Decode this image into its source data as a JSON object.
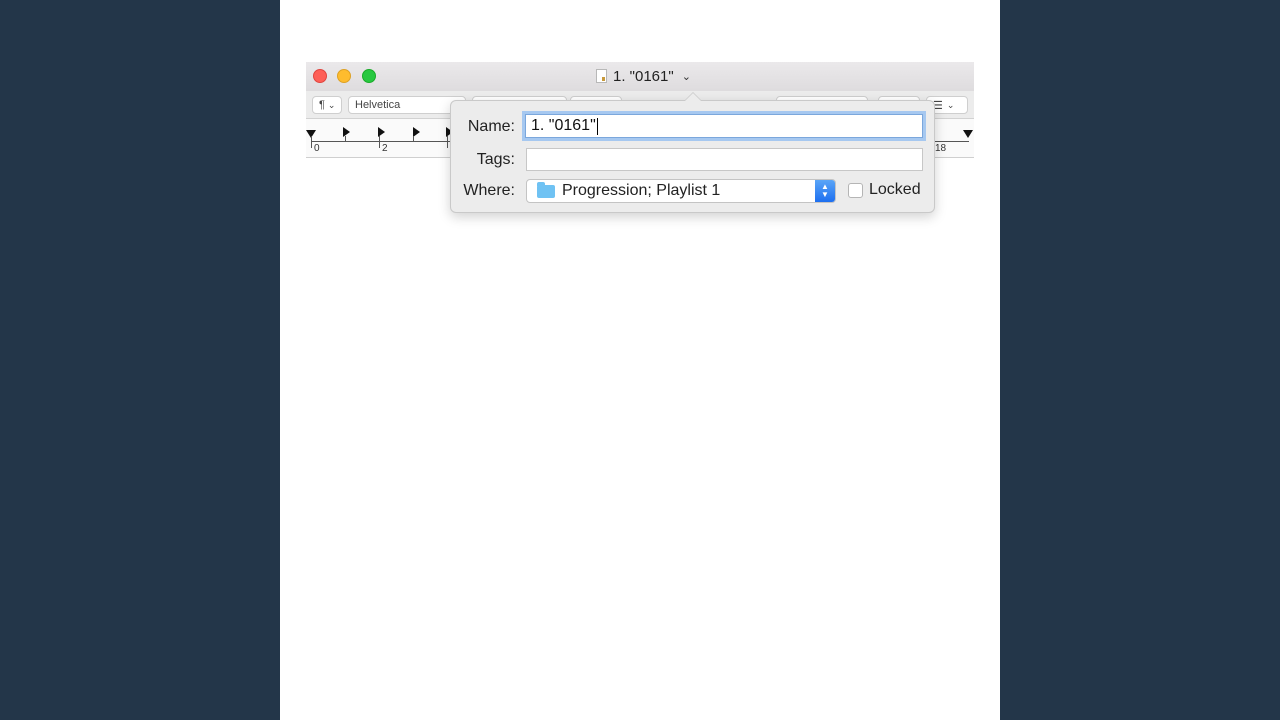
{
  "window": {
    "title": "1. \"0161\"",
    "traffic_lights": [
      "close",
      "minimize",
      "zoom"
    ]
  },
  "toolbar": {
    "paragraph_style": "¶",
    "font_family": "Helvetica"
  },
  "ruler": {
    "numbers": [
      "0",
      "2",
      "18"
    ]
  },
  "popover": {
    "name_label": "Name:",
    "name_value": "1. \"0161\"",
    "tags_label": "Tags:",
    "tags_value": "",
    "where_label": "Where:",
    "where_value": "Progression; Playlist 1",
    "locked_label": "Locked",
    "locked_checked": false
  },
  "colors": {
    "background": "#233649",
    "page": "#ffffff",
    "focus_ring": "#a6c8f0",
    "select_stepper": "#1d6ff0"
  }
}
